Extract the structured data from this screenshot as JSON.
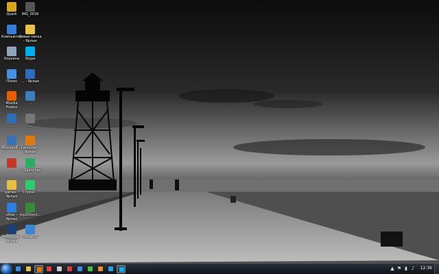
{
  "desktop": {
    "icons": [
      {
        "label": "Quark",
        "name": "quark-icon",
        "color": "#d9a520"
      },
      {
        "label": "IMG_0039",
        "name": "image-file-icon",
        "color": "#555555"
      },
      {
        "label": "Компьютер",
        "name": "computer-icon",
        "color": "#3a7bd5"
      },
      {
        "label": "Новая папка - Ярлык",
        "name": "folder-shortcut-icon",
        "color": "#e8c14a"
      },
      {
        "label": "Корзина",
        "name": "recycle-bin-icon",
        "color": "#8fa4b8"
      },
      {
        "label": "Skype",
        "name": "skype-icon",
        "color": "#00aff0"
      },
      {
        "label": "iTunes",
        "name": "itunes-icon",
        "color": "#4a90e2"
      },
      {
        "label": "... - Ярлык",
        "name": "shortcut-icon",
        "color": "#2c6bc0"
      },
      {
        "label": "Mozilla Firefox",
        "name": "firefox-icon",
        "color": "#e66000"
      },
      {
        "label": "...",
        "name": "program-icon",
        "color": "#3c7fc0"
      },
      {
        "label": "...",
        "name": "program-icon",
        "color": "#2f6db5"
      },
      {
        "label": "...",
        "name": "program-icon",
        "color": "#777777"
      },
      {
        "label": "4Easysoft ...",
        "name": "easysoft-icon",
        "color": "#3a6fb0"
      },
      {
        "label": "Launcher - Ярлык",
        "name": "launcher-icon",
        "color": "#e07a10"
      },
      {
        "label": "...",
        "name": "program-icon",
        "color": "#c0392b"
      },
      {
        "label": "... Launcher",
        "name": "launcher-icon",
        "color": "#27ae60"
      },
      {
        "label": "games - Ярлык",
        "name": "games-shortcut-icon",
        "color": "#e2c044"
      },
      {
        "label": "Crystal...",
        "name": "crystal-icon",
        "color": "#2ecc71"
      },
      {
        "label": "other - Ярлык",
        "name": "other-shortcut-icon",
        "color": "#2f7de1"
      },
      {
        "label": "mp3Direct...",
        "name": "mp3direct-icon",
        "color": "#3b8a3b"
      },
      {
        "label": "Photoshop - Ярлык",
        "name": "photoshop-icon",
        "color": "#1c3f6e"
      },
      {
        "label": "UltraISO",
        "name": "ultraiso-icon",
        "color": "#3a86d0"
      }
    ]
  },
  "taskbar": {
    "items": [
      {
        "name": "taskbar-ie-icon",
        "color": "#3b8de0",
        "active": false
      },
      {
        "name": "taskbar-explorer-icon",
        "color": "#e8c14a",
        "active": false
      },
      {
        "name": "taskbar-app-icon",
        "color": "#e07a10",
        "active": true
      },
      {
        "name": "taskbar-close-app-icon",
        "color": "#e04040",
        "active": false
      },
      {
        "name": "taskbar-window-icon",
        "color": "#cccccc",
        "active": false
      },
      {
        "name": "taskbar-app-icon",
        "color": "#d04040",
        "active": false
      },
      {
        "name": "taskbar-app-icon",
        "color": "#3a8de0",
        "active": false
      },
      {
        "name": "taskbar-app-icon",
        "color": "#48c048",
        "active": false
      },
      {
        "name": "taskbar-app-icon",
        "color": "#e09030",
        "active": false
      },
      {
        "name": "taskbar-app-icon",
        "color": "#2aa0e0",
        "active": false
      },
      {
        "name": "taskbar-skype-icon",
        "color": "#00aff0",
        "active": true
      }
    ],
    "tray": {
      "icons": [
        "▲",
        "⚑",
        "▮",
        "♪"
      ]
    },
    "clock": "12:36"
  },
  "colors": {
    "taskbar_bg": "#1a1e26",
    "sky_top": "#0c0c0c",
    "sea": "#5a5a5a"
  }
}
